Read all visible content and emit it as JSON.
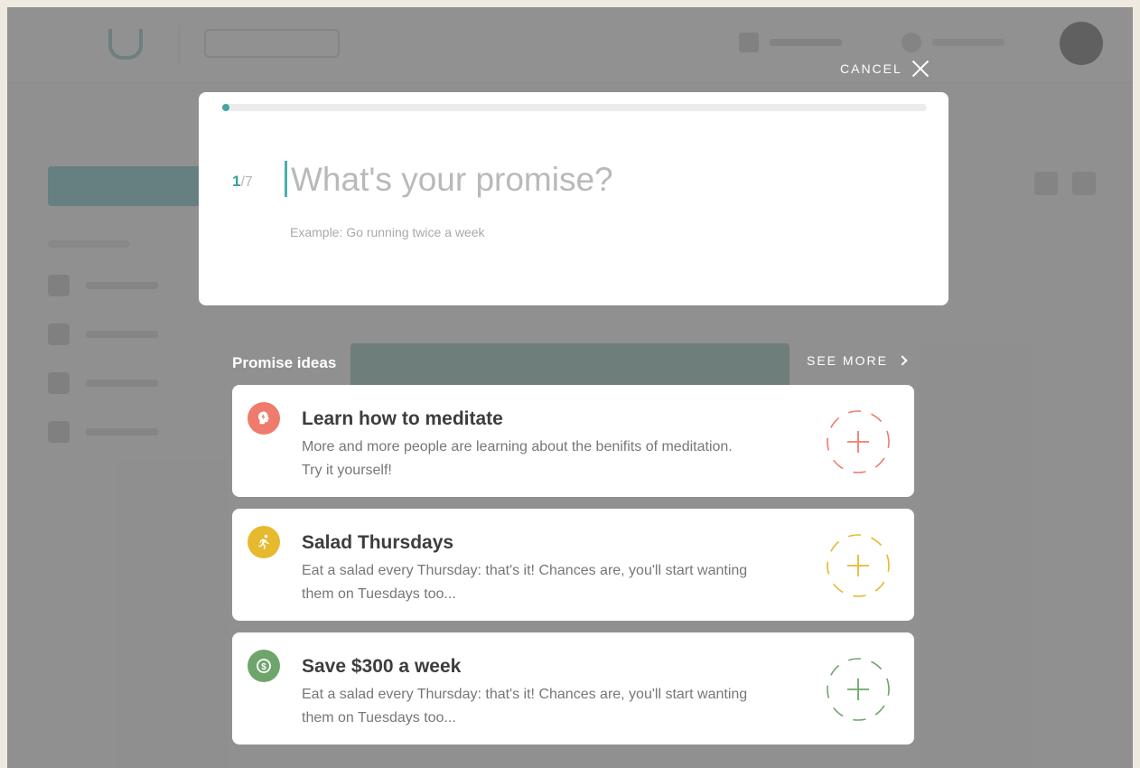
{
  "modal": {
    "cancel_label": "CANCEL",
    "progress": {
      "current": 1,
      "total": 7,
      "fraction": 0.0
    },
    "step_current": "1",
    "step_total": "/7",
    "question_placeholder": "What's your promise?",
    "example": "Example: Go running twice a week"
  },
  "ideas": {
    "title": "Promise ideas",
    "see_more_label": "SEE MORE",
    "items": [
      {
        "title": "Learn how to meditate",
        "desc": "More and more people are learning about the benifits of meditation. Try it yourself!",
        "color": "#ef7b6d",
        "icon": "head-icon"
      },
      {
        "title": "Salad Thursdays",
        "desc": "Eat a salad every Thursday: that's it! Chances are, you'll start wanting them on Tuesdays too...",
        "color": "#e6b92f",
        "icon": "runner-icon"
      },
      {
        "title": "Save $300 a week",
        "desc": "Eat a salad every Thursday: that's it! Chances are, you'll start wanting them on Tuesdays too...",
        "color": "#6fa56c",
        "icon": "dollar-icon"
      }
    ]
  },
  "colors": {
    "accent": "#3fa9a6",
    "overlay": "#6b6b6b"
  }
}
